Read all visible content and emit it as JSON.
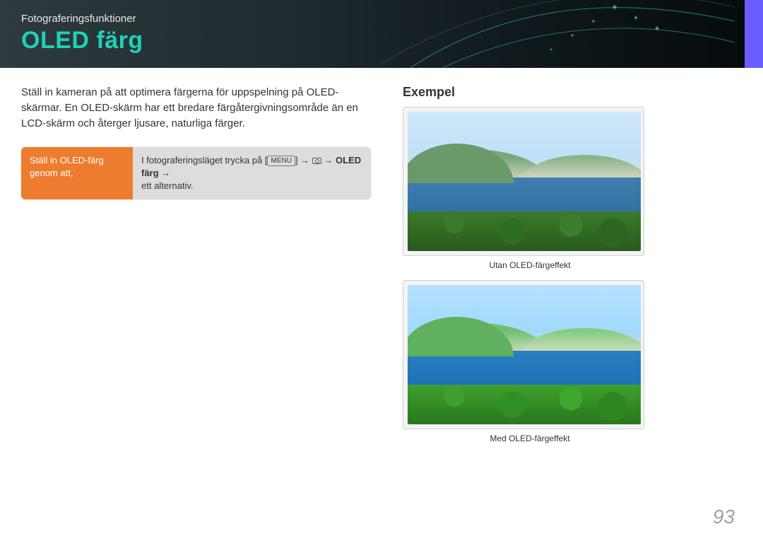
{
  "header": {
    "breadcrumb": "Fotograferingsfunktioner",
    "title": "OLED färg"
  },
  "body": {
    "paragraph": "Ställ in kameran på att optimera färgerna för uppspelning på OLED-skärmar. En OLED-skärm har ett bredare färgåtergivningsområde än en LCD-skärm och återger ljusare, naturliga färger."
  },
  "setting": {
    "label_line1": "Ställ in OLED-färg",
    "label_line2": "genom att,",
    "instr_prefix": "I fotograferingsläget trycka på [",
    "menu_button": "MENU",
    "instr_mid": "] → ",
    "instr_bold": "OLED färg",
    "instr_arrow": " → ",
    "instr_suffix": "ett alternativ."
  },
  "examples": {
    "heading": "Exempel",
    "caption_without": "Utan OLED-färgeffekt",
    "caption_with": "Med OLED-färgeffekt"
  },
  "page_number": "93"
}
